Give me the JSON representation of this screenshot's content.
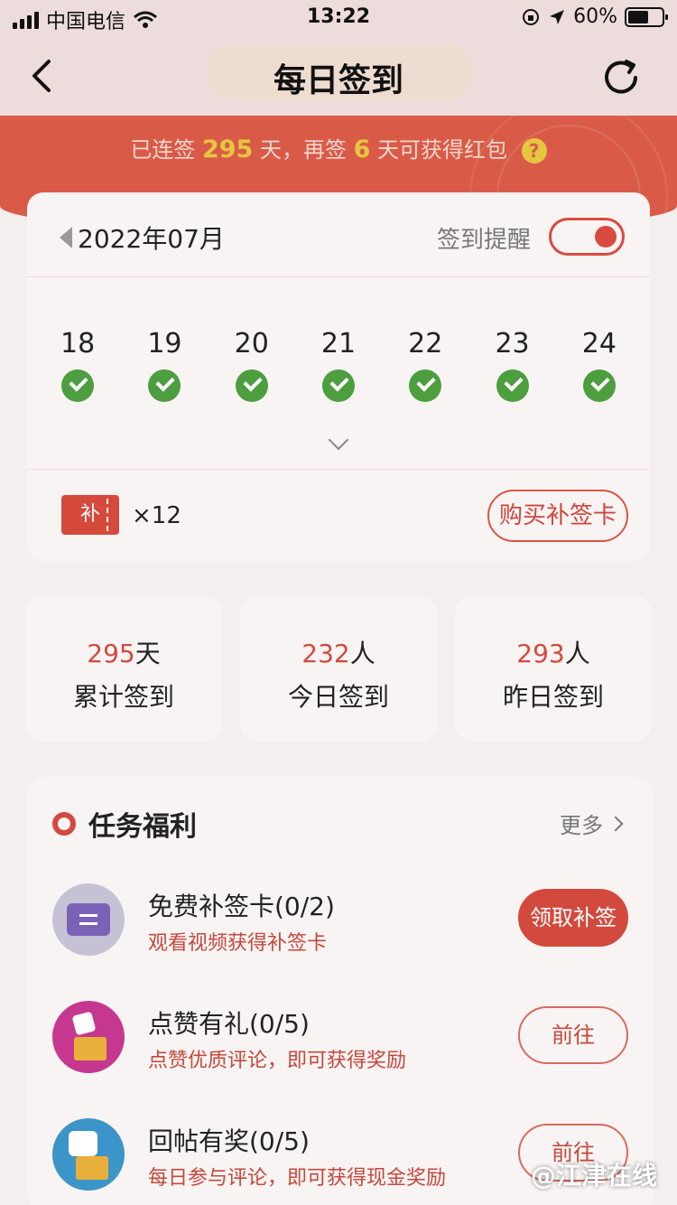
{
  "status_bar": {
    "carrier": "中国电信",
    "time": "13:22",
    "battery": "60%"
  },
  "nav": {
    "title": "每日签到"
  },
  "banner": {
    "prefix": "已连签",
    "streak_days": "295",
    "mid": "天，再签",
    "remaining_days": "6",
    "suffix": "天可获得红包",
    "help_glyph": "?"
  },
  "calendar": {
    "month": "2022年07月",
    "reminder_label": "签到提醒",
    "reminder_on": true,
    "days": [
      {
        "date": "18",
        "signed": true
      },
      {
        "date": "19",
        "signed": true
      },
      {
        "date": "20",
        "signed": true
      },
      {
        "date": "21",
        "signed": true
      },
      {
        "date": "22",
        "signed": true
      },
      {
        "date": "23",
        "signed": true
      },
      {
        "date": "24",
        "signed": true
      }
    ],
    "makeup_card_glyph": "补",
    "makeup_card_count": "×12",
    "buy_button": "购买补签卡"
  },
  "stats": [
    {
      "value": "295",
      "unit": "天",
      "label": "累计签到"
    },
    {
      "value": "232",
      "unit": "人",
      "label": "今日签到"
    },
    {
      "value": "293",
      "unit": "人",
      "label": "昨日签到"
    }
  ],
  "tasks_section": {
    "title": "任务福利",
    "more": "更多",
    "items": [
      {
        "name": "免费补签卡(0/2)",
        "desc": "观看视频获得补签卡",
        "button": "领取补签",
        "icon": "makeup-card-icon"
      },
      {
        "name": "点赞有礼(0/5)",
        "desc": "点赞优质评论，即可获得奖励",
        "button": "前往",
        "icon": "like-gift-icon"
      },
      {
        "name": "回帖有奖(0/5)",
        "desc": "每日参与评论，即可获得现金奖励",
        "button": "前往",
        "icon": "reply-gift-icon"
      }
    ]
  },
  "watermark": "@江津在线",
  "colors": {
    "accent_red": "#d24a3d",
    "check_green": "#4c9e3f",
    "highlight_yellow": "#e6c640"
  }
}
